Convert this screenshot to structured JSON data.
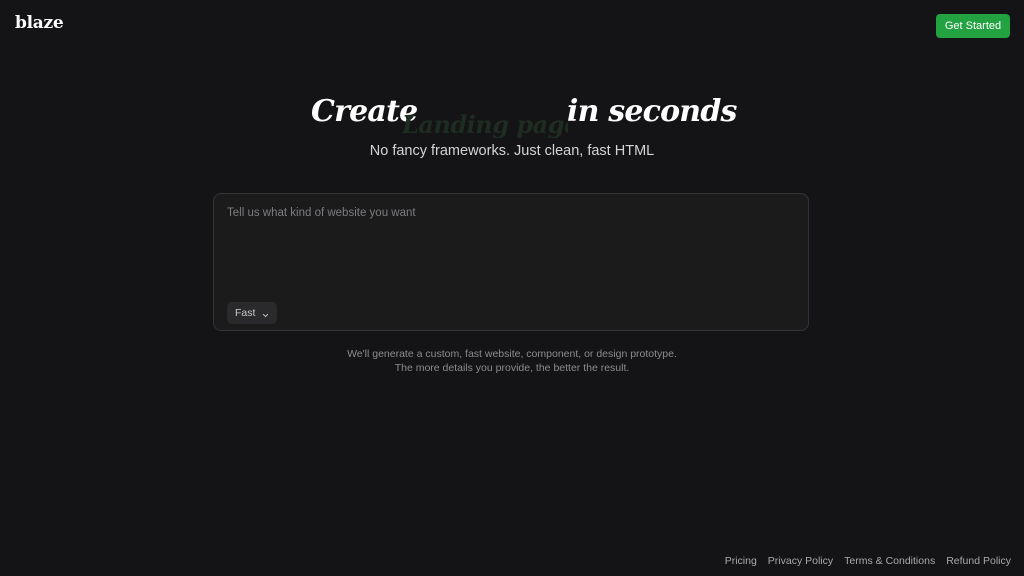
{
  "header": {
    "logo": "blaze",
    "cta_label": "Get Started",
    "cta_color": "#22a240"
  },
  "hero": {
    "title_part1": "Create",
    "title_rotating": "Landing pages",
    "title_part2": "in seconds",
    "subtitle": "No fancy frameworks. Just clean, fast HTML"
  },
  "prompt": {
    "value": "",
    "placeholder": "Tell us what kind of website you want",
    "mode_label": "Fast",
    "mode_icon": "chevron-down-icon"
  },
  "helper": {
    "line1": "We'll generate a custom, fast website, component, or design prototype.",
    "line2": "The more details you provide, the better the result."
  },
  "footer": {
    "links": [
      "Pricing",
      "Privacy Policy",
      "Terms & Conditions",
      "Refund Policy"
    ]
  }
}
